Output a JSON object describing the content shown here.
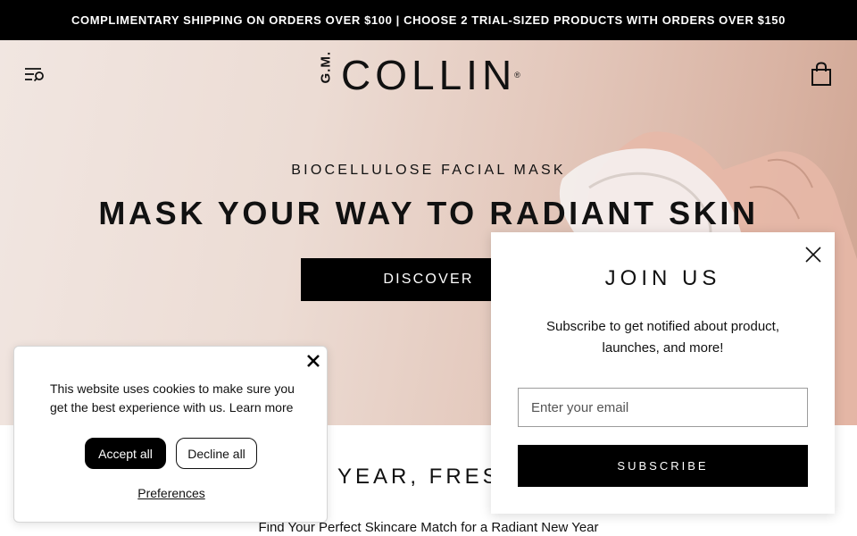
{
  "announcement": {
    "text": "COMPLIMENTARY SHIPPING ON ORDERS OVER $100 | CHOOSE 2 TRIAL-SIZED PRODUCTS WITH ORDERS OVER $150"
  },
  "header": {
    "menu_icon": "menu-search-icon",
    "logo_prefix": "G.M.",
    "logo_text": "COLLIN",
    "logo_mark": "®",
    "cart_icon": "shopping-bag-icon"
  },
  "hero": {
    "eyebrow": "BIOCELLULOSE FACIAL MASK",
    "title": "MASK YOUR WAY TO RADIANT SKIN",
    "cta_label": "DISCOVER"
  },
  "section": {
    "title": "YEAR, FRESH",
    "subtitle": "Find Your Perfect Skincare Match for a Radiant New Year"
  },
  "cookie_banner": {
    "message": "This website uses cookies to make sure you get the best experience with us.",
    "learn_more": "Learn more",
    "accept_label": "Accept all",
    "decline_label": "Decline all",
    "preferences_label": "Preferences",
    "close_icon": "close-icon"
  },
  "newsletter_popup": {
    "title": "JOIN US",
    "text": "Subscribe to get notified about product, launches, and more!",
    "email_placeholder": "Enter your email",
    "email_value": "",
    "submit_label": "SUBSCRIBE",
    "close_icon": "close-icon"
  },
  "colors": {
    "announcement_bg": "#000000",
    "button_bg": "#000000",
    "hero_bg": "#ecdcd4"
  }
}
